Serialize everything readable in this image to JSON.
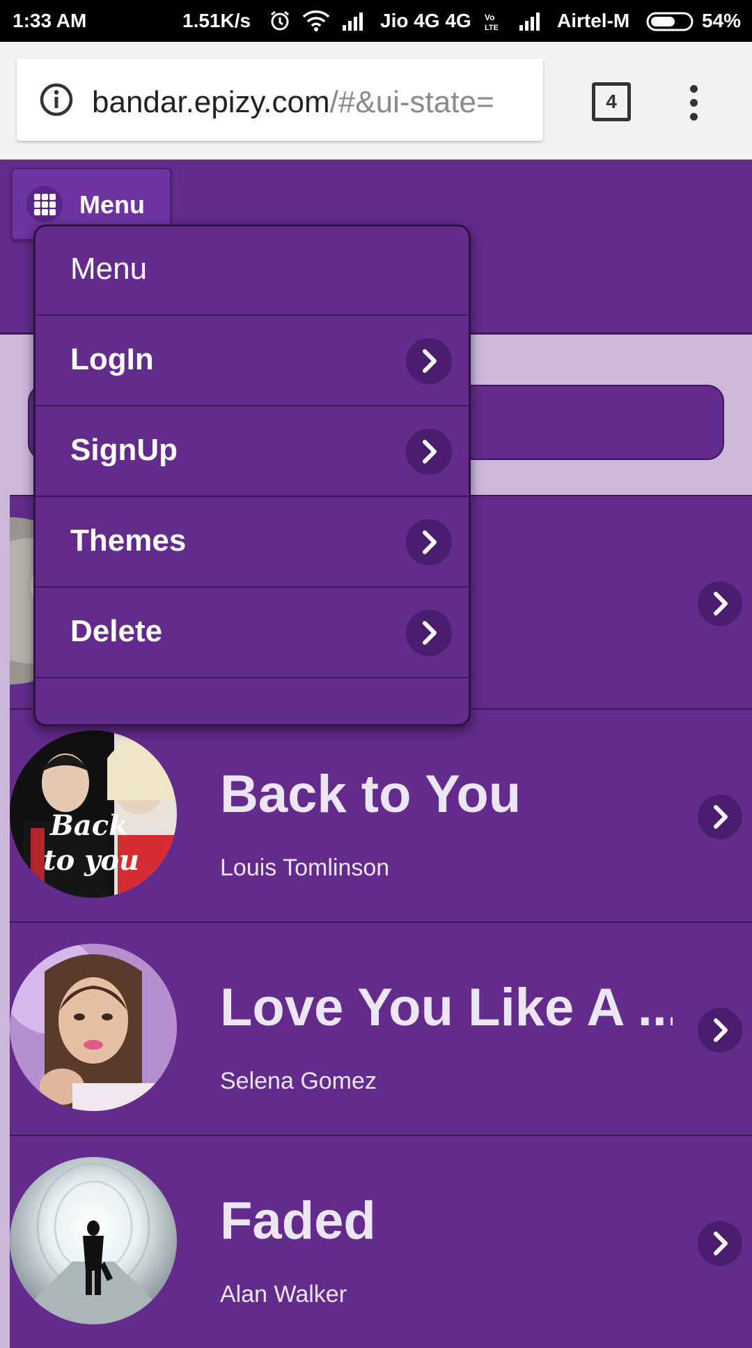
{
  "status_bar": {
    "time": "1:33 AM",
    "net_speed": "1.51K/s",
    "carrier1": "Jio 4G 4G",
    "carrier2": "Airtel-M",
    "battery": "54%"
  },
  "browser": {
    "url_domain": "bandar.epizy.com",
    "url_path": "/#&ui-state=",
    "tab_count": "4"
  },
  "header": {
    "menu_button_label": "Menu"
  },
  "search": {
    "value": ""
  },
  "popup": {
    "heading": "Menu",
    "items": [
      {
        "label": "LogIn"
      },
      {
        "label": "SignUp"
      },
      {
        "label": "Themes"
      },
      {
        "label": "Delete"
      }
    ]
  },
  "songs": [
    {
      "title": "",
      "artist": ""
    },
    {
      "title": "Back to You",
      "artist": "Louis Tomlinson"
    },
    {
      "title": "Love You Like A ...",
      "artist": "Selena Gomez"
    },
    {
      "title": "Faded",
      "artist": "Alan Walker"
    }
  ],
  "colors": {
    "theme_purple": "#632b8c",
    "page_lavender": "#cdb7da",
    "chevron_circle": "#4a1d6e"
  }
}
